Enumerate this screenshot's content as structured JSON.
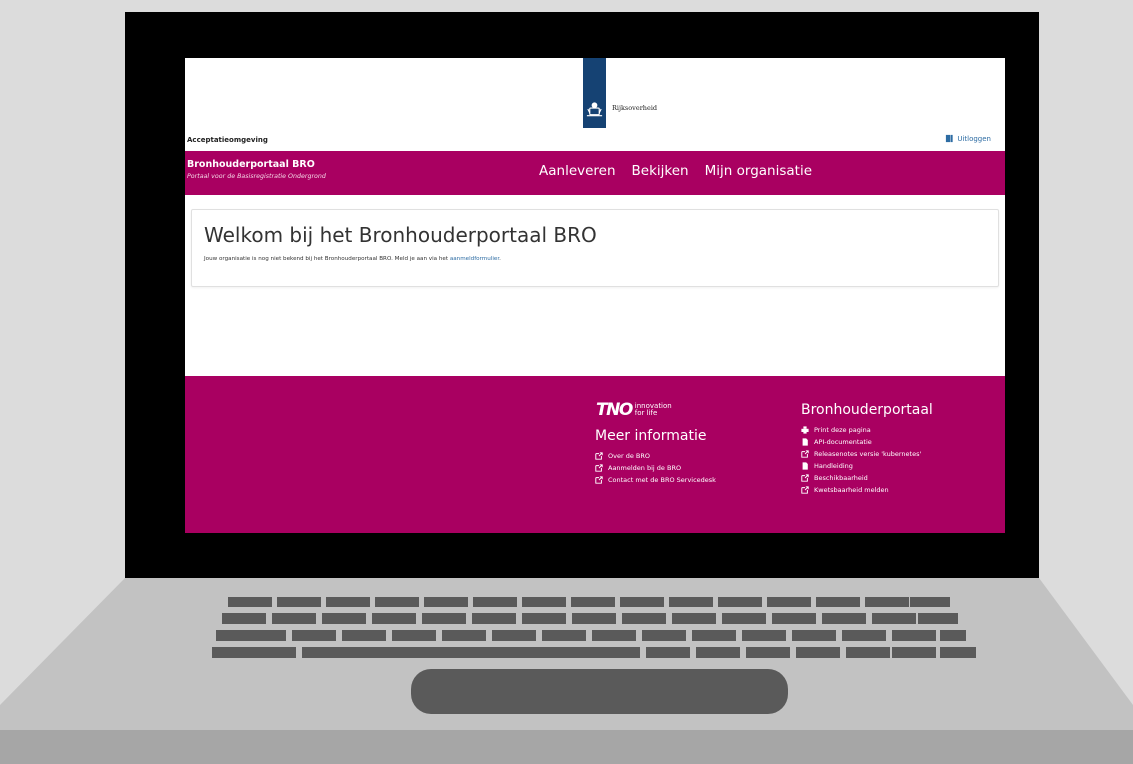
{
  "header": {
    "gov_name": "Rijksoverheid",
    "environment": "Acceptatieomgeving",
    "logout_label": "Uitloggen"
  },
  "navbar": {
    "brand_title": "Bronhouderportaal BRO",
    "brand_subtitle": "Portaal voor de Basisregistratie Ondergrond",
    "items": [
      {
        "label": "Aanleveren"
      },
      {
        "label": "Bekijken"
      },
      {
        "label": "Mijn organisatie"
      }
    ]
  },
  "welcome": {
    "title": "Welkom bij het Bronhouderportaal BRO",
    "text": "Jouw organisatie is nog niet bekend bij het Bronhouderportaal BRO. Meld je aan via het ",
    "link": "aanmeldformulier",
    "suffix": "."
  },
  "footer": {
    "tno_mark": "TNO",
    "tno_line1": "innovation",
    "tno_line2": "for life",
    "meer_title": "Meer informatie",
    "meer_links": [
      {
        "label": "Over de BRO",
        "icon": "external-link-icon"
      },
      {
        "label": "Aanmelden bij de BRO",
        "icon": "external-link-icon"
      },
      {
        "label": "Contact met de BRO Servicedesk",
        "icon": "external-link-icon"
      }
    ],
    "bron_title": "Bronhouderportaal",
    "bron_links": [
      {
        "label": "Print deze pagina",
        "icon": "print-icon"
      },
      {
        "label": "API-documentatie",
        "icon": "file-icon"
      },
      {
        "label": "Releasenotes versie 'kubernetes'",
        "icon": "external-link-icon"
      },
      {
        "label": "Handleiding",
        "icon": "file-icon"
      },
      {
        "label": "Beschikbaarheid",
        "icon": "external-link-icon"
      },
      {
        "label": "Kwetsbaarheid melden",
        "icon": "external-link-icon"
      }
    ]
  },
  "colors": {
    "brand": "#a90061",
    "gov_blue": "#154273",
    "link": "#2d6ca3"
  }
}
